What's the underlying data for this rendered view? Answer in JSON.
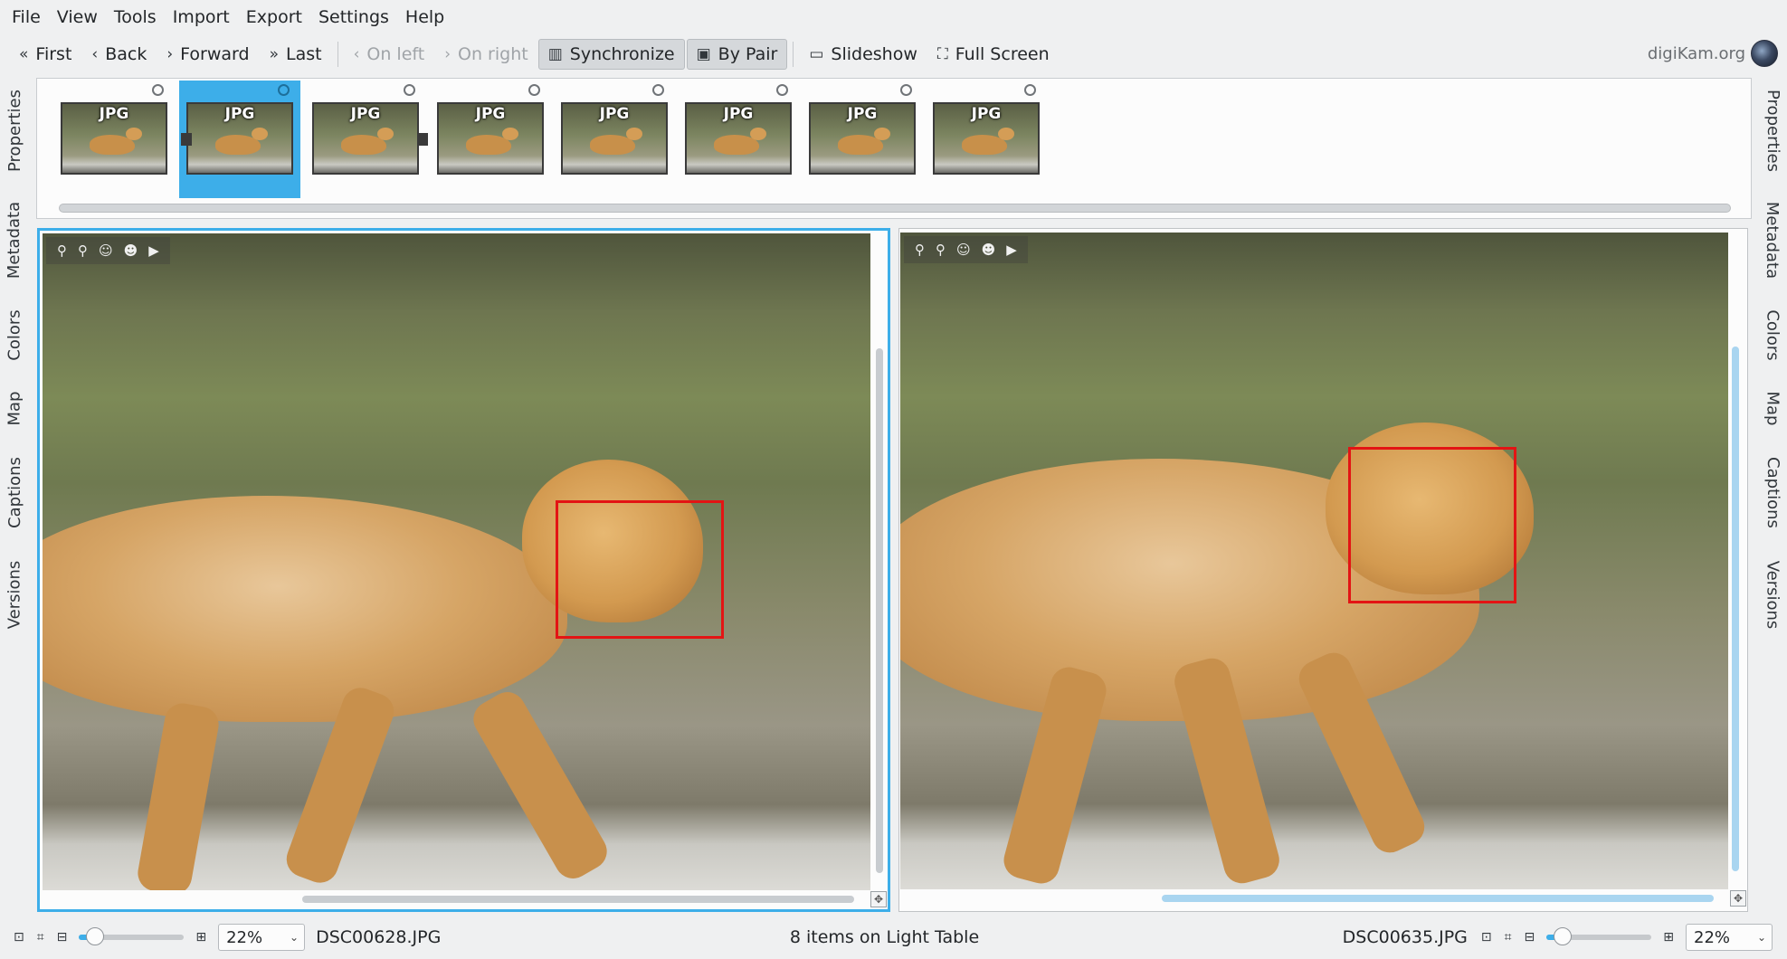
{
  "menu": [
    "File",
    "View",
    "Tools",
    "Import",
    "Export",
    "Settings",
    "Help"
  ],
  "toolbar": {
    "first": "First",
    "back": "Back",
    "forward": "Forward",
    "last": "Last",
    "on_left": "On left",
    "on_right": "On right",
    "synchronize": "Synchronize",
    "by_pair": "By Pair",
    "slideshow": "Slideshow",
    "full_screen": "Full Screen"
  },
  "brand": "digiKam.org",
  "left_sidebar": [
    "Properties",
    "Metadata",
    "Colors",
    "Map",
    "Captions",
    "Versions"
  ],
  "right_sidebar": [
    "Properties",
    "Metadata",
    "Colors",
    "Map",
    "Captions",
    "Versions"
  ],
  "filmstrip": {
    "thumbs": [
      {
        "badge": "JPG",
        "selected": false
      },
      {
        "badge": "JPG",
        "selected": true
      },
      {
        "badge": "JPG",
        "selected": false
      },
      {
        "badge": "JPG",
        "selected": false
      },
      {
        "badge": "JPG",
        "selected": false
      },
      {
        "badge": "JPG",
        "selected": false
      },
      {
        "badge": "JPG",
        "selected": false
      },
      {
        "badge": "JPG",
        "selected": false
      }
    ]
  },
  "left_pane": {
    "filename": "DSC00628.JPG",
    "zoom": "22%",
    "zoom_level": 0.15
  },
  "right_pane": {
    "filename": "DSC00635.JPG",
    "zoom": "22%",
    "zoom_level": 0.15
  },
  "status": {
    "items_text": "8 items on Light Table"
  },
  "colors": {
    "accent": "#3daee9",
    "face_box": "#e31414"
  },
  "icons": {
    "first": "double-chevron-left-icon",
    "back": "chevron-left-icon",
    "forward": "chevron-right-icon",
    "last": "double-chevron-right-icon",
    "synchronize": "columns-icon",
    "by_pair": "pair-icon",
    "slideshow": "monitor-icon",
    "full_screen": "fullscreen-icon"
  }
}
